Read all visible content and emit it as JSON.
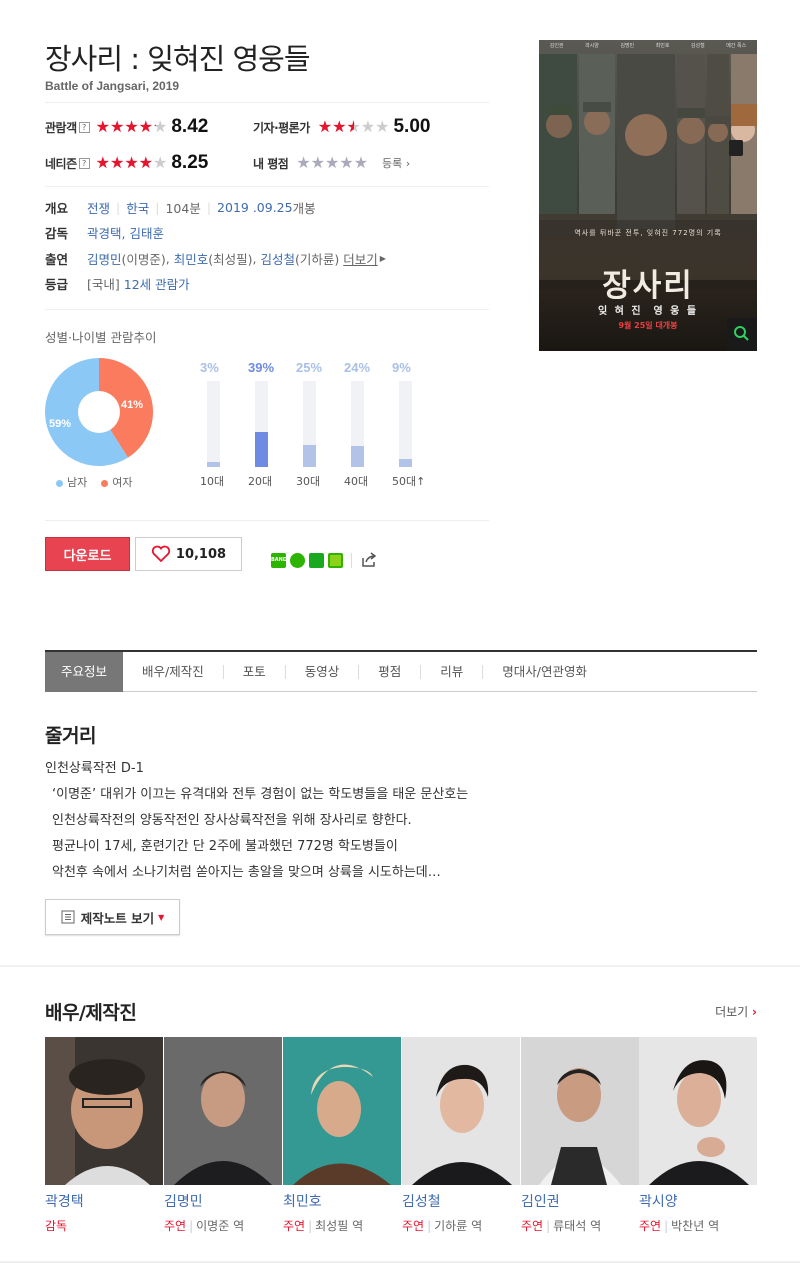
{
  "movie": {
    "title": "장사리 : 잊혀진 영웅들",
    "subtitle": "Battle of Jangsari, 2019"
  },
  "ratings": {
    "audience": {
      "label": "관람객",
      "help": "?",
      "score": "8.42",
      "stars": 4.2
    },
    "critics": {
      "label": "기자·평론가",
      "score": "5.00",
      "stars": 2.5
    },
    "netizen": {
      "label": "네티즌",
      "help": "?",
      "score": "8.25",
      "stars": 4.1
    },
    "mine": {
      "label": "내 평점",
      "stars": 0,
      "register_label": "등록"
    }
  },
  "info": {
    "overview": {
      "label": "개요",
      "genre": "전쟁",
      "country": "한국",
      "runtime": "104분",
      "release_date": "2019 .09.25",
      "release_suffix": "개봉"
    },
    "director": {
      "label": "감독",
      "names": "곽경택, 김태훈"
    },
    "cast": {
      "label": "출연",
      "actor1": "김명민",
      "role1": "(이명준)",
      "actor2": "최민호",
      "role2": "(최성필)",
      "actor3": "김성철",
      "role3": "(기하륜)",
      "more": "더보기"
    },
    "rating": {
      "label": "등급",
      "region": "[국내]",
      "value": "12세 관람가"
    }
  },
  "poster": {
    "top_names": [
      "김인권",
      "곽시양",
      "김명민",
      "최민호",
      "김성철",
      "메간 폭스"
    ],
    "tagline": "역사를 뒤바꾼 전투, 잊혀진 772명의 기록",
    "title": "장사리",
    "subtitle": "잊 혀 진  영 웅 들",
    "release": "9월 25일 대개봉"
  },
  "demographics": {
    "label": "성별·나이별 관람추이",
    "gender": {
      "male_pct": 59,
      "female_pct": 41,
      "male_label": "59%",
      "female_label": "41%",
      "male_legend": "남자",
      "female_legend": "여자"
    },
    "colors": {
      "male": "#8cc8f6",
      "female": "#fb7b5e"
    },
    "ages": [
      {
        "label": "10대",
        "pct_label": "3%",
        "value": 3
      },
      {
        "label": "20대",
        "pct_label": "39%",
        "value": 39,
        "highlight": true
      },
      {
        "label": "30대",
        "pct_label": "25%",
        "value": 25
      },
      {
        "label": "40대",
        "pct_label": "24%",
        "value": 24
      },
      {
        "label": "50대↑",
        "pct_label": "9%",
        "value": 9
      }
    ]
  },
  "actions": {
    "download": "다운로드",
    "like_count": "10,108"
  },
  "tabs": [
    "주요정보",
    "배우/제작진",
    "포토",
    "동영상",
    "평점",
    "리뷰",
    "명대사/연관영화"
  ],
  "synopsis": {
    "heading": "줄거리",
    "lines": [
      "인천상륙작전 D-1",
      "‘이명준’ 대위가 이끄는 유격대와 전투 경험이 없는 학도병들을 태운 문산호는",
      "인천상륙작전의 양동작전인 장사상륙작전을 위해 장사리로 향한다.",
      "평균나이 17세, 훈련기간 단 2주에 불과했던 772명 학도병들이",
      "악천후 속에서 소나기처럼 쏟아지는 총알을 맞으며 상륙을 시도하는데…"
    ],
    "note_button": "제작노트 보기"
  },
  "cast_section": {
    "heading": "배우/제작진",
    "more": "더보기",
    "members": [
      {
        "name": "곽경택",
        "role": "감독",
        "character": ""
      },
      {
        "name": "김명민",
        "role": "주연",
        "character": "이명준 역"
      },
      {
        "name": "최민호",
        "role": "주연",
        "character": "최성필 역"
      },
      {
        "name": "김성철",
        "role": "주연",
        "character": "기하륜 역"
      },
      {
        "name": "김인권",
        "role": "주연",
        "character": "류태석 역"
      },
      {
        "name": "곽시양",
        "role": "주연",
        "character": "박찬년 역"
      }
    ]
  }
}
